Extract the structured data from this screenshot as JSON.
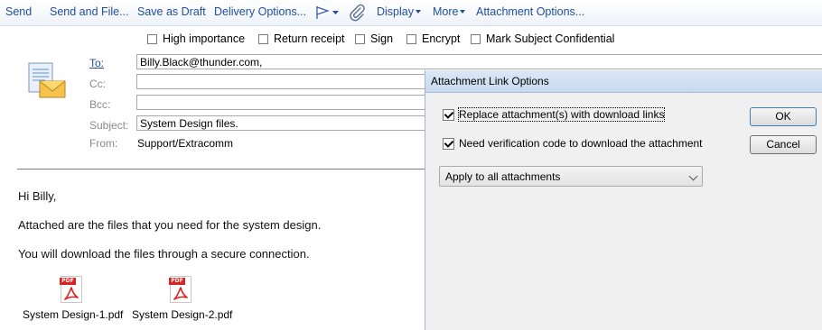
{
  "toolbar": {
    "send": "Send",
    "send_and_file": "Send and File...",
    "save_as_draft": "Save as Draft",
    "delivery_options": "Delivery Options...",
    "display": "Display",
    "more": "More",
    "attachment_options": "Attachment Options..."
  },
  "options": {
    "high_importance": "High importance",
    "return_receipt": "Return receipt",
    "sign": "Sign",
    "encrypt": "Encrypt",
    "mark_subject_confidential": "Mark Subject Confidential"
  },
  "header": {
    "to_label": "To:",
    "to_value": "Billy.Black@thunder.com,",
    "cc_label": "Cc:",
    "cc_value": "",
    "bcc_label": "Bcc:",
    "bcc_value": "",
    "subject_label": "Subject:",
    "subject_value": "System Design files.",
    "from_label": "From:",
    "from_value": "Support/Extracomm"
  },
  "body": {
    "greeting": "Hi Billy,",
    "line1": "Attached are the files that you need for the system design.",
    "line2": "You will download the files through a secure connection."
  },
  "attachments": [
    {
      "name": "System Design-1.pdf",
      "icon": "pdf-file-icon",
      "tag": "PDF"
    },
    {
      "name": "System Design-2.pdf",
      "icon": "pdf-file-icon",
      "tag": "PDF"
    }
  ],
  "dialog": {
    "title": "Attachment Link Options",
    "replace_label": "Replace attachment(s) with download links",
    "replace_checked": true,
    "verification_label": "Need verification code to download the attachment",
    "verification_checked": true,
    "apply_select": "Apply to all attachments",
    "ok": "OK",
    "cancel": "Cancel"
  },
  "colors": {
    "link_blue": "#1f4e9e",
    "pdf_red": "#d22222"
  }
}
